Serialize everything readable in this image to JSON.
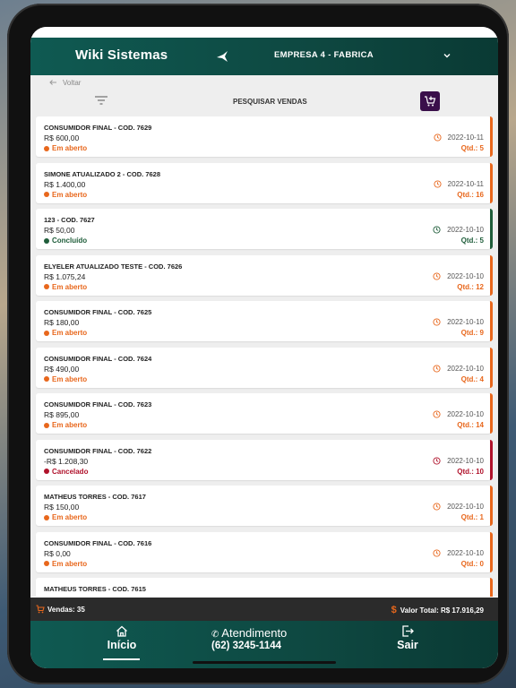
{
  "app": {
    "title": "Wiki Sistemas",
    "company": "EMPRESA 4 - FABRICA"
  },
  "toolbar": {
    "back_label": "Voltar",
    "search_label": "PESQUISAR VENDAS"
  },
  "colors": {
    "open": "#e8671c",
    "done": "#1f5d3a",
    "cancelled": "#b0122b",
    "header": "#0e4841",
    "cart_button": "#3a0f4a"
  },
  "sales": [
    {
      "title": "CONSUMIDOR FINAL - COD. 7629",
      "amount": "R$ 600,00",
      "status": "Em aberto",
      "date": "2022-10-11",
      "qtd": "Qtd.: 5",
      "kind": "open"
    },
    {
      "title": "SIMONE ATUALIZADO 2 - COD. 7628",
      "amount": "R$ 1.400,00",
      "status": "Em aberto",
      "date": "2022-10-11",
      "qtd": "Qtd.: 16",
      "kind": "open"
    },
    {
      "title": "123 - COD. 7627",
      "amount": "R$ 50,00",
      "status": "Concluído",
      "date": "2022-10-10",
      "qtd": "Qtd.: 5",
      "kind": "done"
    },
    {
      "title": "ELYELER ATUALIZADO TESTE - COD. 7626",
      "amount": "R$ 1.075,24",
      "status": "Em aberto",
      "date": "2022-10-10",
      "qtd": "Qtd.: 12",
      "kind": "open"
    },
    {
      "title": "CONSUMIDOR FINAL - COD. 7625",
      "amount": "R$ 180,00",
      "status": "Em aberto",
      "date": "2022-10-10",
      "qtd": "Qtd.: 9",
      "kind": "open"
    },
    {
      "title": "CONSUMIDOR FINAL - COD. 7624",
      "amount": "R$ 490,00",
      "status": "Em aberto",
      "date": "2022-10-10",
      "qtd": "Qtd.: 4",
      "kind": "open"
    },
    {
      "title": "CONSUMIDOR FINAL - COD. 7623",
      "amount": "R$ 895,00",
      "status": "Em aberto",
      "date": "2022-10-10",
      "qtd": "Qtd.: 14",
      "kind": "open"
    },
    {
      "title": "CONSUMIDOR FINAL - COD. 7622",
      "amount": "-R$ 1.208,30",
      "status": "Cancelado",
      "date": "2022-10-10",
      "qtd": "Qtd.: 10",
      "kind": "cancelled"
    },
    {
      "title": "MATHEUS TORRES - COD. 7617",
      "amount": "R$ 150,00",
      "status": "Em aberto",
      "date": "2022-10-10",
      "qtd": "Qtd.: 1",
      "kind": "open"
    },
    {
      "title": "CONSUMIDOR FINAL - COD. 7616",
      "amount": "R$ 0,00",
      "status": "Em aberto",
      "date": "2022-10-10",
      "qtd": "Qtd.: 0",
      "kind": "open"
    },
    {
      "title": "MATHEUS TORRES - COD. 7615",
      "amount": "",
      "status": "",
      "date": "",
      "qtd": "",
      "kind": "open"
    }
  ],
  "summary": {
    "sales_count": "Vendas: 35",
    "total_value": "Valor Total: R$ 17.916,29"
  },
  "tabs": {
    "home": "Início",
    "support": "Atendimento",
    "support_phone": "(62) 3245-1144",
    "exit": "Sair"
  }
}
